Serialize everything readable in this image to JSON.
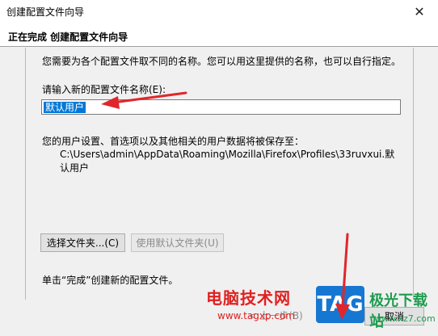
{
  "window": {
    "title": "创建配置文件向导",
    "close_glyph": "✕"
  },
  "wizard": {
    "heading": "正在完成 创建配置文件向导"
  },
  "content": {
    "intro_text": "您需要为各个配置文件取不同的名称。您可以用这里提供的名称，也可以自行指定。",
    "name_label": "请输入新的配置文件名称(E):",
    "name_value": "默认用户",
    "save_label": "您的用户设置、首选项以及其他相关的用户数据将被保存至：",
    "save_path": "C:\\Users\\admin\\AppData\\Roaming\\Mozilla\\Firefox\\Profiles\\33ruvxui.默认用户",
    "choose_folder_button": "选择文件夹...(C)",
    "default_folder_button": "使用默认文件夹(U)",
    "finish_note": "单击“完成”创建新的配置文件。"
  },
  "footer": {
    "prev_button": "< 上一步(B)",
    "cancel_button": "取消"
  },
  "watermark": {
    "site_name": "电脑技术网",
    "url": "www.tagxp.com",
    "tag": "TAG",
    "download": "极光下载站",
    "xz_url": "www.xz7.com"
  },
  "colors": {
    "selection": "#0078d7",
    "arrow": "#e0262b"
  }
}
